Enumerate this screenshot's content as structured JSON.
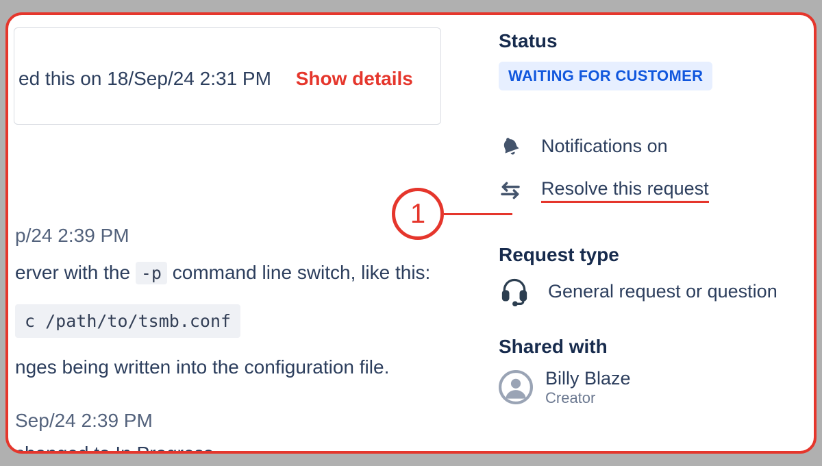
{
  "card": {
    "text_fragment": "ed this on 18/Sep/24 2:31 PM",
    "show_details": "Show details"
  },
  "left": {
    "ts1": "p/24 2:39 PM",
    "line_server_prefix": "erver with the",
    "flag": "-p",
    "line_server_suffix": "command line switch, like this:",
    "code_prefix": "c",
    "code_path": "/path/to/tsmb.conf",
    "line_conf": "nges being written into the configuration file.",
    "ts2": "Sep/24 2:39 PM",
    "line_status": "changed to In Progress."
  },
  "sidebar": {
    "status_title": "Status",
    "status_value": "WAITING FOR CUSTOMER",
    "notifications": "Notifications on",
    "resolve": "Resolve this request",
    "req_type_title": "Request type",
    "req_type_value": "General request or question",
    "shared_title": "Shared with",
    "shared_name": "Billy Blaze",
    "shared_role": "Creator"
  },
  "annotation": {
    "number": "1"
  }
}
